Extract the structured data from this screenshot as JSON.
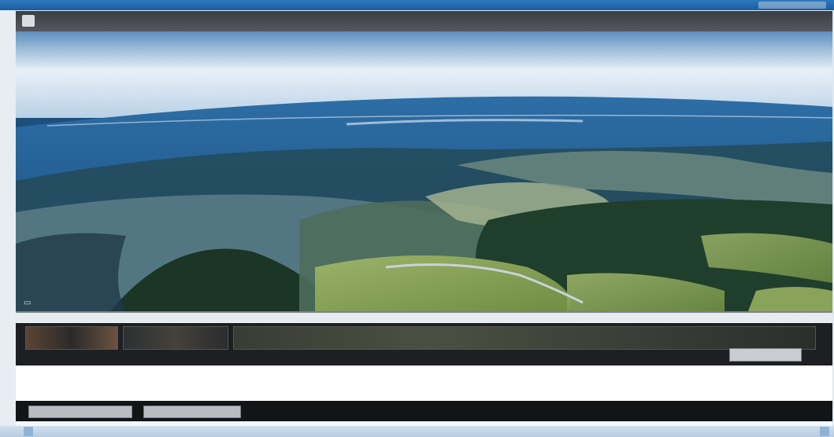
{
  "window": {
    "title": "",
    "controls": [
      "minimize",
      "maximize",
      "close"
    ]
  },
  "viewer": {
    "title": "",
    "subtitle": "",
    "photo": {
      "subject": "aerial-landscape",
      "colors": {
        "sky": "#e9f1f7",
        "sea": "#1d5a8e",
        "forest": "#1f3f2c",
        "field": "#8aa35a"
      }
    }
  },
  "caption": "",
  "filmstrip": {
    "label": "",
    "button_label": ""
  },
  "info": {
    "col1_title": "",
    "col1_value": "",
    "col2_title": "",
    "col2_value": "",
    "col3_value": "",
    "col4_value": ""
  },
  "footer": {
    "button1_label": "",
    "button2_label": "",
    "text": ""
  },
  "taskbar": {
    "left_label": "",
    "right_label": ""
  },
  "colors": {
    "accent": "#1b5d9e",
    "header_dark": "#3a3d42",
    "footer_dark": "#121416"
  }
}
